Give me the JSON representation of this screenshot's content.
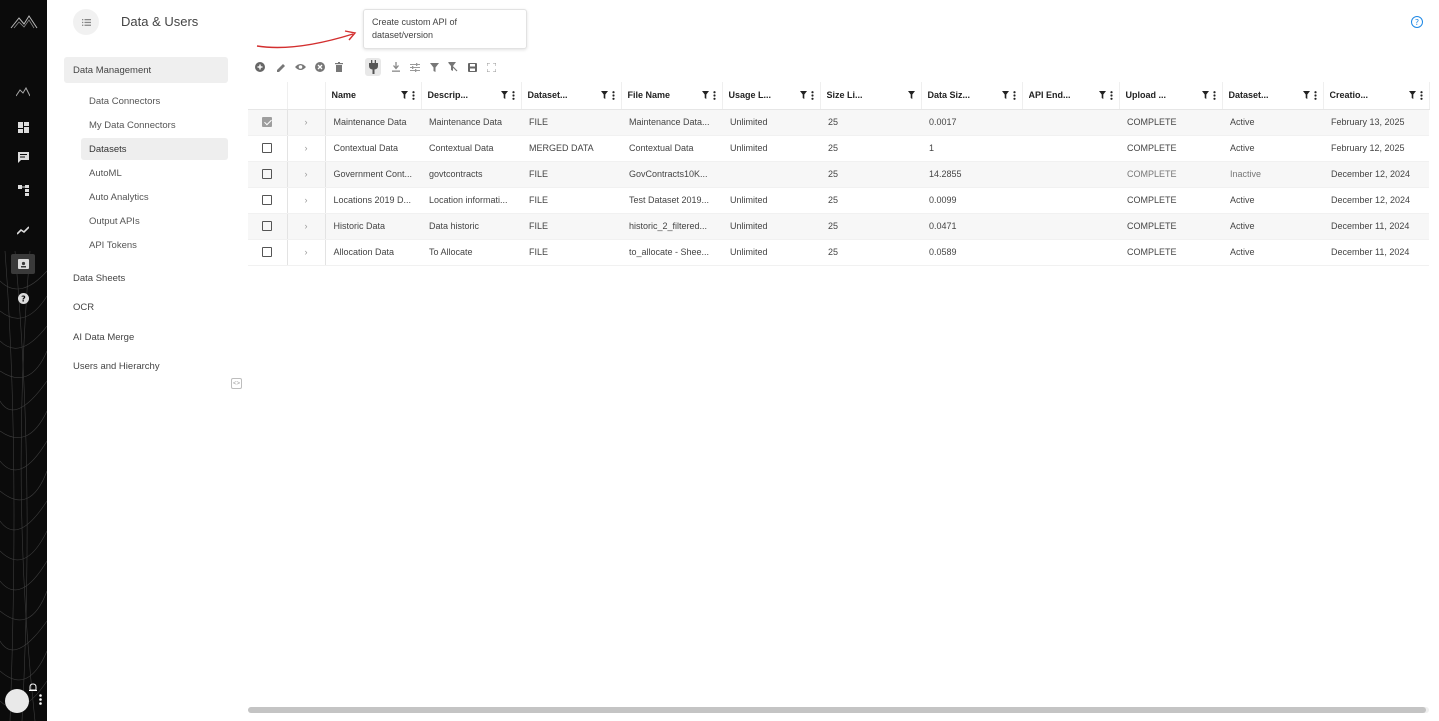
{
  "header": {
    "title": "Data & Users"
  },
  "tooltip": {
    "text": "Create custom API of dataset/version"
  },
  "sidebar": {
    "items": [
      {
        "label": "Data Management"
      },
      {
        "label": "Data Connectors"
      },
      {
        "label": "My Data Connectors"
      },
      {
        "label": "Datasets"
      },
      {
        "label": "AutoML"
      },
      {
        "label": "Auto Analytics"
      },
      {
        "label": "Output APIs"
      },
      {
        "label": "API Tokens"
      },
      {
        "label": "Data Sheets"
      },
      {
        "label": "OCR"
      },
      {
        "label": "AI Data Merge"
      },
      {
        "label": "Users and Hierarchy"
      }
    ],
    "active": "Datasets"
  },
  "toolbar": {
    "buttons": [
      {
        "icon": "add-circle-icon"
      },
      {
        "icon": "edit-pencil-icon"
      },
      {
        "icon": "view-eye-icon"
      },
      {
        "icon": "cancel-circle-icon"
      },
      {
        "icon": "delete-trash-icon"
      },
      {
        "icon": "api-plug-icon"
      },
      {
        "icon": "download-icon"
      },
      {
        "icon": "tune-icon"
      },
      {
        "icon": "filter-icon"
      },
      {
        "icon": "clear-filter-icon"
      },
      {
        "icon": "save-icon"
      },
      {
        "icon": "fullscreen-icon"
      }
    ]
  },
  "grid": {
    "columns": [
      "Name",
      "Descrip...",
      "Dataset...",
      "File Name",
      "Usage L...",
      "Size Li...",
      "Data Siz...",
      "API End...",
      "Upload ...",
      "Dataset...",
      "Creatio..."
    ],
    "rows": [
      {
        "checked": true,
        "cells": [
          "Maintenance Data",
          "Maintenance Data",
          "FILE",
          "Maintenance Data...",
          "Unlimited",
          "25",
          "0.0017",
          "",
          "COMPLETE",
          "Active",
          "February 13, 2025"
        ]
      },
      {
        "checked": false,
        "cells": [
          "Contextual Data",
          "Contextual Data",
          "MERGED DATA",
          "Contextual Data",
          "Unlimited",
          "25",
          "1",
          "",
          "COMPLETE",
          "Active",
          "February 12, 2025"
        ]
      },
      {
        "checked": false,
        "cells": [
          "Government Cont...",
          "govtcontracts",
          "FILE",
          "GovContracts10K...",
          "",
          "25",
          "14.2855",
          "",
          "COMPLETE",
          "Inactive",
          "December 12, 2024"
        ]
      },
      {
        "checked": false,
        "cells": [
          "Locations 2019 D...",
          "Location informati...",
          "FILE",
          "Test Dataset 2019...",
          "Unlimited",
          "25",
          "0.0099",
          "",
          "COMPLETE",
          "Active",
          "December 12, 2024"
        ]
      },
      {
        "checked": false,
        "cells": [
          "Historic Data",
          "Data historic",
          "FILE",
          "historic_2_filtered...",
          "Unlimited",
          "25",
          "0.0471",
          "",
          "COMPLETE",
          "Active",
          "December 11, 2024"
        ]
      },
      {
        "checked": false,
        "cells": [
          "Allocation Data",
          "To Allocate",
          "FILE",
          "to_allocate - Shee...",
          "Unlimited",
          "25",
          "0.0589",
          "",
          "COMPLETE",
          "Active",
          "December 11, 2024"
        ]
      }
    ]
  },
  "colors": {
    "rail": "#0b0b0b",
    "accent_arrow": "#d32f2f",
    "help": "#1e88e5"
  }
}
